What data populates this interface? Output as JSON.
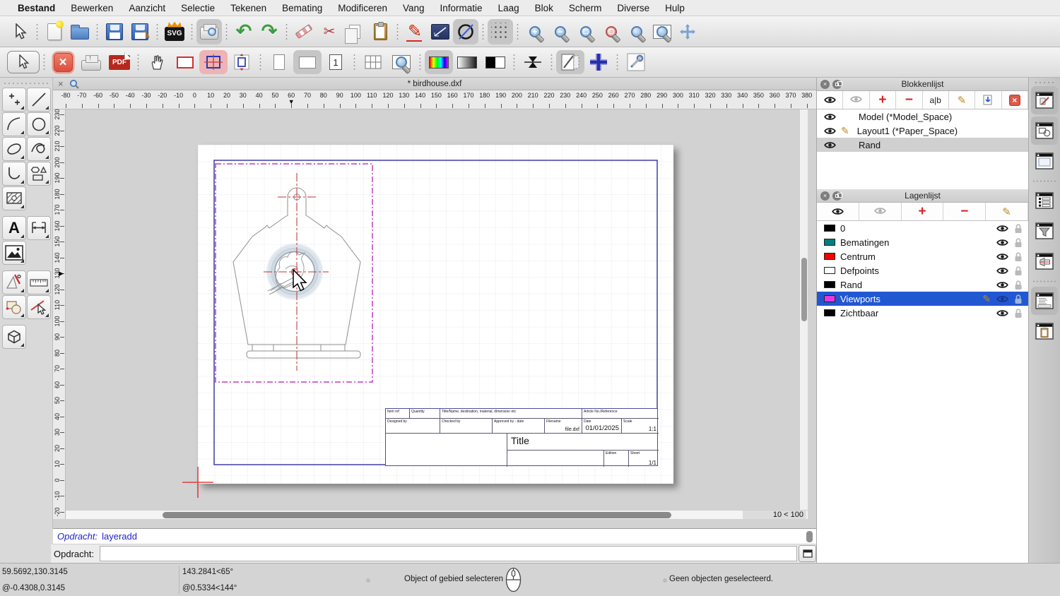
{
  "window": {
    "doc_title": "* birdhouse.dxf",
    "grid_status": "10 < 100"
  },
  "menubar": {
    "items": [
      "Bestand",
      "Bewerken",
      "Aanzicht",
      "Selectie",
      "Tekenen",
      "Bemating",
      "Modificeren",
      "Vang",
      "Informatie",
      "Laag",
      "Blok",
      "Scherm",
      "Diverse",
      "Hulp"
    ]
  },
  "glyphs": {
    "close": "×",
    "marker_down": "▼",
    "marker_right": "▶",
    "plus": "+",
    "minus": "−",
    "pencil": "✎",
    "scissors": "✂",
    "undo": "↶",
    "redo": "↷",
    "text_tool": "A",
    "svg_label": "SVG",
    "pdf_label": "PDF",
    "page_one": "1",
    "rename": "a|b"
  },
  "toolbar_main": {
    "items": [
      {
        "name": "select-tool",
        "icon": "cursor"
      },
      {
        "sep": true
      },
      {
        "name": "new-file-button",
        "icon": "newfile"
      },
      {
        "name": "open-file-button",
        "icon": "folder"
      },
      {
        "sep": true
      },
      {
        "name": "save-button",
        "icon": "save"
      },
      {
        "name": "save-as-button",
        "icon": "saveas"
      },
      {
        "sep": true
      },
      {
        "name": "svg-export-button",
        "icon": "svg"
      },
      {
        "sep": true
      },
      {
        "name": "print-preview-button",
        "icon": "printpreview",
        "active": true
      },
      {
        "sep": true
      },
      {
        "name": "undo-button",
        "icon": "undo"
      },
      {
        "name": "redo-button",
        "icon": "redo"
      },
      {
        "sep": true
      },
      {
        "name": "erase-button",
        "icon": "eraser"
      },
      {
        "name": "cut-button",
        "icon": "cut"
      },
      {
        "name": "copy-button",
        "icon": "copy"
      },
      {
        "name": "paste-button",
        "icon": "paste"
      },
      {
        "sep": true
      },
      {
        "name": "freehand-draw-button",
        "icon": "redpencil"
      },
      {
        "name": "reference-line-button",
        "icon": "navyline"
      },
      {
        "name": "circle-slash-button",
        "icon": "circleslash",
        "active": true
      },
      {
        "sep": true
      },
      {
        "name": "grid-toggle-button",
        "icon": "griddots",
        "active": true
      },
      {
        "sep": true
      },
      {
        "name": "zoom-in-button",
        "icon": "zoomin"
      },
      {
        "name": "zoom-out-button",
        "icon": "zoomout"
      },
      {
        "name": "zoom-auto-button",
        "icon": "zoomauto"
      },
      {
        "name": "zoom-selection-button",
        "icon": "zoomsel"
      },
      {
        "name": "zoom-previous-button",
        "icon": "zoomprev"
      },
      {
        "name": "zoom-window-button",
        "icon": "zoomwin"
      },
      {
        "name": "pan-button",
        "icon": "pan"
      }
    ]
  },
  "toolbar_print": {
    "items": [
      {
        "name": "select-tool-2",
        "icon": "cursorbtn"
      },
      {
        "sep": true
      },
      {
        "name": "close-print-preview-button",
        "icon": "closered"
      },
      {
        "name": "print-button",
        "icon": "printer"
      },
      {
        "name": "pdf-export-button",
        "icon": "pdf"
      },
      {
        "sep": true
      },
      {
        "name": "pan-paper-button",
        "icon": "hand"
      },
      {
        "name": "paper-border-button",
        "icon": "redrect"
      },
      {
        "name": "viewport-highlight-button",
        "icon": "pinkrect",
        "active": "pink"
      },
      {
        "name": "fit-drawing-button",
        "icon": "fitrect"
      },
      {
        "sep": true
      },
      {
        "name": "page-portrait-button",
        "icon": "portrait"
      },
      {
        "name": "page-landscape-button",
        "icon": "landscape",
        "active": true
      },
      {
        "name": "single-page-button",
        "icon": "pageone"
      },
      {
        "sep": true
      },
      {
        "name": "multi-page-button",
        "icon": "tiles"
      },
      {
        "name": "zoom-page-button",
        "icon": "zoompage"
      },
      {
        "sep": true
      },
      {
        "name": "full-color-button",
        "icon": "colorbar",
        "active": true
      },
      {
        "name": "grayscale-button",
        "icon": "graybar"
      },
      {
        "name": "black-white-button",
        "icon": "bwbar"
      },
      {
        "sep": true
      },
      {
        "name": "scale-compress-button",
        "icon": "hourglass"
      },
      {
        "sep": true
      },
      {
        "name": "drawing-settings-button",
        "icon": "pagepencil",
        "active": true
      },
      {
        "name": "crosshair-button",
        "icon": "bluecross"
      },
      {
        "sep": true
      },
      {
        "name": "preferences-button",
        "icon": "tools"
      }
    ]
  },
  "toolbox": {
    "rows": [
      [
        {
          "name": "points-tool",
          "icon": "points"
        },
        {
          "name": "line-tool",
          "icon": "line"
        }
      ],
      [
        {
          "name": "arc-tool",
          "icon": "arc"
        },
        {
          "name": "circle-tool",
          "icon": "circle"
        }
      ],
      [
        {
          "name": "ellipse-tool",
          "icon": "ellipse"
        },
        {
          "name": "spline-tool",
          "icon": "spline"
        }
      ],
      [
        {
          "name": "polyline-tool",
          "icon": "polyline"
        },
        {
          "name": "shape-tool",
          "icon": "shapes"
        }
      ],
      [
        {
          "name": "hatch-tool",
          "icon": "hatch"
        },
        null
      ],
      "gap",
      [
        {
          "name": "text-tool",
          "icon": "texttool"
        },
        {
          "name": "dimension-tool",
          "icon": "dim"
        }
      ],
      [
        {
          "name": "image-tool",
          "icon": "image"
        },
        null
      ],
      "gap",
      [
        {
          "name": "draft-tools",
          "icon": "draft"
        },
        {
          "name": "measure-tool",
          "icon": "rulertool"
        }
      ],
      [
        {
          "name": "block-tools",
          "icon": "blockicons"
        },
        {
          "name": "modify-tools",
          "icon": "modify"
        }
      ],
      "gap",
      [
        {
          "name": "solid-tools",
          "icon": "solid"
        },
        null
      ]
    ]
  },
  "rulers": {
    "h_labels": [
      "-80",
      "-70",
      "-60",
      "-50",
      "-40",
      "-30",
      "-20",
      "-10",
      "0",
      "10",
      "20",
      "30",
      "40",
      "50",
      "60",
      "70",
      "80",
      "90",
      "100",
      "110",
      "120",
      "130",
      "140",
      "150",
      "160",
      "170",
      "180",
      "190",
      "200",
      "210",
      "220",
      "230",
      "240",
      "250",
      "260",
      "270",
      "280",
      "290",
      "300",
      "310",
      "320",
      "330",
      "340",
      "350",
      "360",
      "370",
      "380"
    ],
    "h_marker_value": "60",
    "v_labels": [
      "230",
      "220",
      "210",
      "200",
      "190",
      "180",
      "170",
      "160",
      "150",
      "140",
      "130",
      "120",
      "110",
      "100",
      "90",
      "80",
      "70",
      "60",
      "50",
      "40",
      "30",
      "20",
      "10",
      "0",
      "-10",
      "-20"
    ],
    "v_marker_value": "130"
  },
  "titleblock": {
    "item_ref": "Item ref",
    "quantity": "Quantity",
    "title_name": "Title/Name, destination, material, dimension etc",
    "article": "Article No./Reference",
    "designed_by": "Designed by",
    "checked_by": "Checked by",
    "approved": "Approved by - date",
    "filename_label": "Filename",
    "filename": "file.dxf",
    "date_label": "Date",
    "date": "01/01/2025",
    "scale_label": "Scale",
    "scale": "1:1",
    "title": "Title",
    "edition": "Edition",
    "sheet_label": "Sheet",
    "sheet": "1/1"
  },
  "block_panel": {
    "title": "Blokkenlijst",
    "items": [
      {
        "name": "Model (*Model_Space)",
        "editing": false,
        "selected": false
      },
      {
        "name": "Layout1 (*Paper_Space)",
        "editing": true,
        "selected": false
      },
      {
        "name": "Rand",
        "editing": false,
        "selected": true
      }
    ]
  },
  "layer_panel": {
    "title": "Lagenlijst",
    "layers": [
      {
        "name": "0",
        "color": "#000000",
        "selected": false,
        "editing": false
      },
      {
        "name": "Bematingen",
        "color": "#007d7d",
        "selected": false,
        "editing": false
      },
      {
        "name": "Centrum",
        "color": "#f40000",
        "selected": false,
        "editing": false
      },
      {
        "name": "Defpoints",
        "color": "#ffffff",
        "selected": false,
        "editing": false
      },
      {
        "name": "Rand",
        "color": "#000000",
        "selected": false,
        "editing": false
      },
      {
        "name": "Viewports",
        "color": "#e338e3",
        "selected": true,
        "editing": true
      },
      {
        "name": "Zichtbaar",
        "color": "#000000",
        "selected": false,
        "editing": false
      }
    ]
  },
  "dock": {
    "items": [
      {
        "name": "dock-property-editor",
        "icon": "wpencil",
        "active": true
      },
      {
        "name": "dock-selection-info",
        "icon": "wshapes",
        "active": true
      },
      {
        "name": "dock-viewport",
        "icon": "wviewport",
        "active": false
      },
      {
        "sep": true
      },
      {
        "name": "dock-block-list",
        "icon": "wlist",
        "active": false
      },
      {
        "name": "dock-filter",
        "icon": "wfilter",
        "active": false
      },
      {
        "name": "dock-projection",
        "icon": "wlight",
        "active": false
      },
      {
        "sep": true
      },
      {
        "name": "dock-command-history",
        "icon": "wcommand",
        "active": true
      },
      {
        "name": "dock-clipboard",
        "icon": "wclipboard",
        "active": false
      }
    ]
  },
  "command": {
    "history_label": "Opdracht:",
    "history_value": "layeradd",
    "prompt_label": "Opdracht:",
    "input_value": ""
  },
  "statusbar": {
    "abs_coord": "59.5692,130.3145",
    "rel_coord": "@-0.4308,0.3145",
    "abs_polar": "143.2841<65°",
    "rel_polar": "@0.5334<144°",
    "hint": "Object of gebied selecteren",
    "selection": "Geen objecten geselecteerd."
  },
  "colors": {
    "paper_border": "#4a4aa8",
    "viewport_dashed": "#c43cc4",
    "centerline": "#c23232",
    "selection_blue": "#2257d2",
    "accent_red": "#d92222"
  }
}
